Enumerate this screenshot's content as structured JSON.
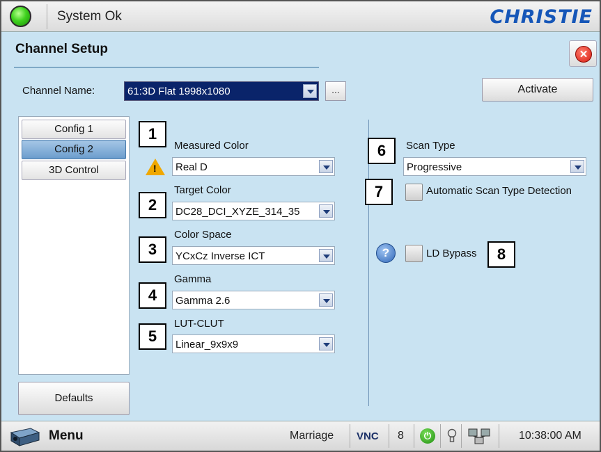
{
  "status": {
    "text": "System Ok",
    "led_color": "#3fd21e",
    "brand": "CHRISTIE"
  },
  "header": {
    "title": "Channel Setup",
    "close_icon": "close-icon"
  },
  "channel": {
    "label": "Channel Name:",
    "selected": "61:3D Flat 1998x1080",
    "more_label": "...",
    "activate_label": "Activate"
  },
  "tabs": [
    {
      "label": "Config 1",
      "active": false
    },
    {
      "label": "Config 2",
      "active": true
    },
    {
      "label": "3D Control",
      "active": false
    }
  ],
  "defaults_label": "Defaults",
  "fields": {
    "measured_color": {
      "label": "Measured Color",
      "value": "Real D"
    },
    "target_color": {
      "label": "Target Color",
      "value": "DC28_DCI_XYZE_314_35"
    },
    "color_space": {
      "label": "Color Space",
      "value": "YCxCz Inverse ICT"
    },
    "gamma": {
      "label": "Gamma",
      "value": "Gamma 2.6"
    },
    "lut_clut": {
      "label": "LUT-CLUT",
      "value": "Linear_9x9x9"
    },
    "scan_type": {
      "label": "Scan Type",
      "value": "Progressive"
    },
    "auto_scan": {
      "label": "Automatic Scan Type Detection",
      "checked": false
    },
    "ld_bypass": {
      "label": "LD Bypass",
      "checked": false
    }
  },
  "callouts": [
    "1",
    "2",
    "3",
    "4",
    "5",
    "6",
    "7",
    "8"
  ],
  "bottom": {
    "menu_label": "Menu",
    "marriage": "Marriage",
    "vnc": "VNC",
    "count": "8",
    "time": "10:38:00 AM"
  },
  "colors": {
    "panel_bg": "#c9e3f2",
    "selection": "#0a246a",
    "brand": "#1556b8",
    "active_tab": "#6b9dcd"
  }
}
